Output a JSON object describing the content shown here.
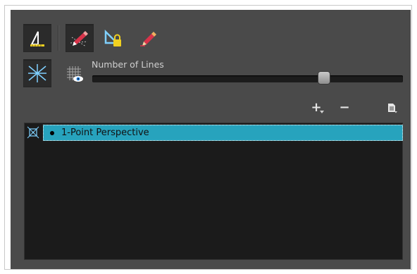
{
  "toolbar": {
    "tools": [
      {
        "name": "perspective-guide-tool",
        "pressed": true
      },
      {
        "name": "vanishing-point-tool",
        "pressed": true
      },
      {
        "name": "lock-guide-tool",
        "pressed": false
      },
      {
        "name": "draw-guide-tool",
        "pressed": false
      },
      {
        "name": "grid-lines-tool",
        "pressed": true
      },
      {
        "name": "show-grid-tool",
        "pressed": false
      }
    ]
  },
  "lines": {
    "label": "Number of Lines",
    "slider_value_fraction": 0.745
  },
  "list_actions": {
    "add": "+",
    "remove": "−",
    "menu": "menu-icon"
  },
  "guides": {
    "items": [
      {
        "label": "1-Point Perspective",
        "selected": true
      }
    ]
  },
  "colors": {
    "panel_bg": "#4a4a4a",
    "list_bg": "#1b1b1b",
    "selection": "#27a3bd",
    "accent_yellow": "#f0d020",
    "accent_red": "#d9334a"
  }
}
